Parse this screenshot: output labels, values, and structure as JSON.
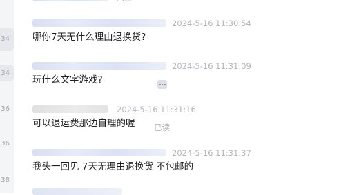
{
  "rail": {
    "labels": [
      "34",
      "34",
      "36",
      "36",
      "38"
    ]
  },
  "top_partial": {
    "read_label": "已读"
  },
  "messages": [
    {
      "timestamp": "2024-5-16 11:30:54",
      "content": "哪你7天无什么理由退换货?"
    },
    {
      "timestamp": "2024-5-16 11:31:09",
      "content": "玩什么文字游戏?"
    },
    {
      "timestamp": "2024-5-16 11:31:16",
      "content": "可以退运费那边自理的喔",
      "read_label": "已读"
    },
    {
      "timestamp": "2024-5-16 11:31:37",
      "content": "我头一回见 7天无理由退换货 不包邮的"
    }
  ],
  "colors": {
    "rail_bg": "#f4f5f7",
    "timestamp": "#b2b5bb",
    "message_text": "#1f1f1f",
    "sender_blur_blue": "#d9dff3",
    "sender_blur_grey": "#e0e0e0"
  },
  "icons": {
    "more": "more-icon"
  }
}
